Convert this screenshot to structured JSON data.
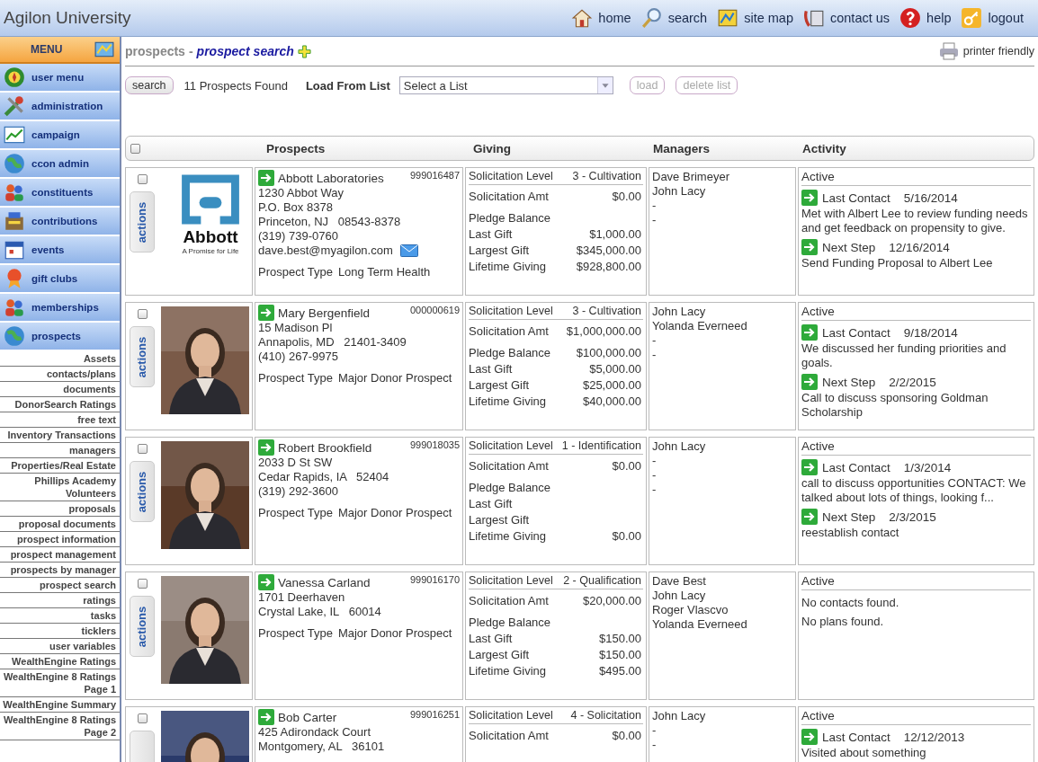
{
  "app_title": "Agilon University",
  "nav": [
    {
      "label": "home"
    },
    {
      "label": "search"
    },
    {
      "label": "site map"
    },
    {
      "label": "contact us"
    },
    {
      "label": "help"
    },
    {
      "label": "logout"
    }
  ],
  "sidebar": {
    "menu_title": "MENU",
    "items": [
      {
        "label": "user menu"
      },
      {
        "label": "administration"
      },
      {
        "label": "campaign"
      },
      {
        "label": "ccon admin"
      },
      {
        "label": "constituents"
      },
      {
        "label": "contributions"
      },
      {
        "label": "events"
      },
      {
        "label": "gift clubs"
      },
      {
        "label": "memberships"
      },
      {
        "label": "prospects"
      }
    ],
    "subitems": [
      "Assets",
      "contacts/plans",
      "documents",
      "DonorSearch Ratings",
      "free text",
      "Inventory Transactions",
      "managers",
      "Properties/Real Estate",
      "Phillips Academy Volunteers",
      "proposals",
      "proposal documents",
      "prospect information",
      "prospect management",
      "prospects by manager",
      "prospect search",
      "ratings",
      "tasks",
      "ticklers",
      "user variables",
      "WealthEngine Ratings",
      "WealthEngine 8 Ratings Page 1",
      "WealthEngine Summary",
      "WealthEngine 8 Ratings Page 2"
    ]
  },
  "breadcrumb": {
    "section": "prospects",
    "separator": "-",
    "page": "prospect search"
  },
  "printer_link": "printer friendly",
  "toolbar": {
    "buttons": [
      {
        "label": "search",
        "disabled": false
      }
    ],
    "found": "11 Prospects Found",
    "list_label": "Load From List",
    "list_select": {
      "value": "Select a List"
    },
    "list_buttons": [
      {
        "label": "load",
        "disabled": true
      },
      {
        "label": "delete list",
        "disabled": true
      }
    ]
  },
  "table": {
    "select_all": {
      "checked": false
    },
    "columns": [
      "Prospects",
      "Giving",
      "Managers",
      "Activity"
    ],
    "rows": [
      {
        "selected": false,
        "action": "actions",
        "image": {
          "kind": "logo",
          "name": "Abbott",
          "tagline": "A Promise for Life"
        },
        "name": "Abbott Laboratories",
        "id": "999016487",
        "address": [
          "1230 Abbot Way",
          "P.O. Box 8378",
          "Princeton, NJ   08543-8378",
          "(319) 739-0760"
        ],
        "email": "dave.best@myagilon.com",
        "type_label": "Prospect Type",
        "type": "Long Term Health",
        "level_label": "Solicitation Level",
        "level": "3 - Cultivation",
        "giving": [
          {
            "label": "Solicitation Amt",
            "value": "$0.00"
          },
          {
            "label": "Pledge Balance"
          },
          {
            "label": "Last Gift",
            "value": "$1,000.00"
          },
          {
            "label": "Largest Gift",
            "value": "$345,000.00"
          },
          {
            "label": "Lifetime Giving",
            "value": "$928,800.00"
          }
        ],
        "managers": [
          "Dave Brimeyer",
          "John Lacy",
          "-",
          "-"
        ],
        "status": "Active",
        "activity": [
          {
            "kind": "event",
            "label": "Last Contact",
            "date": "5/16/2014",
            "text": "Met with Albert Lee to review funding needs and get feedback on propensity to give."
          },
          {
            "kind": "event",
            "label": "Next Step",
            "date": "12/16/2014",
            "text": "Send Funding Proposal to Albert Lee"
          }
        ]
      },
      {
        "selected": false,
        "action": "actions",
        "image": {
          "kind": "picture"
        },
        "name": "Mary Bergenfield",
        "id": "000000619",
        "address": [
          "15 Madison Pl",
          "Annapolis, MD   21401-3409",
          "(410) 267-9975"
        ],
        "type_label": "Prospect Type",
        "type": "Major Donor Prospect",
        "level_label": "Solicitation Level",
        "level": "3 - Cultivation",
        "giving": [
          {
            "label": "Solicitation Amt",
            "value": "$1,000,000.00"
          },
          {
            "label": "Pledge Balance",
            "value": "$100,000.00"
          },
          {
            "label": "Last Gift",
            "value": "$5,000.00"
          },
          {
            "label": "Largest Gift",
            "value": "$25,000.00"
          },
          {
            "label": "Lifetime Giving",
            "value": "$40,000.00"
          }
        ],
        "managers": [
          "John Lacy",
          "Yolanda Everneed",
          "-",
          "-"
        ],
        "status": "Active",
        "activity": [
          {
            "kind": "event",
            "label": "Last Contact",
            "date": "9/18/2014",
            "text": "We discussed her funding priorities and goals."
          },
          {
            "kind": "event",
            "label": "Next Step",
            "date": "2/2/2015",
            "text": "Call to discuss sponsoring Goldman Scholarship"
          }
        ]
      },
      {
        "selected": false,
        "action": "actions",
        "image": {
          "kind": "picture"
        },
        "name": "Robert Brookfield",
        "id": "999018035",
        "address": [
          "2033 D St SW",
          "Cedar Rapids, IA   52404",
          "(319) 292-3600"
        ],
        "type_label": "Prospect Type",
        "type": "Major Donor Prospect",
        "level_label": "Solicitation Level",
        "level": "1 - Identification",
        "giving": [
          {
            "label": "Solicitation Amt",
            "value": "$0.00"
          },
          {
            "label": "Pledge Balance"
          },
          {
            "label": "Last Gift"
          },
          {
            "label": "Largest Gift"
          },
          {
            "label": "Lifetime Giving",
            "value": "$0.00"
          }
        ],
        "managers": [
          "John Lacy",
          "-",
          "-",
          "-"
        ],
        "status": "Active",
        "activity": [
          {
            "kind": "event",
            "label": "Last Contact",
            "date": "1/3/2014",
            "text": "call to discuss opportunities CONTACT: We talked about lots of things, looking f..."
          },
          {
            "kind": "event",
            "label": "Next Step",
            "date": "2/3/2015",
            "text": "reestablish contact"
          }
        ]
      },
      {
        "selected": false,
        "action": "actions",
        "image": {
          "kind": "picture"
        },
        "name": "Vanessa Carland",
        "id": "999016170",
        "address": [
          "1701 Deerhaven",
          "Crystal Lake, IL   60014"
        ],
        "type_label": "Prospect Type",
        "type": "Major Donor Prospect",
        "level_label": "Solicitation Level",
        "level": "2 - Qualification",
        "giving": [
          {
            "label": "Solicitation Amt",
            "value": "$20,000.00"
          },
          {
            "label": "Pledge Balance"
          },
          {
            "label": "Last Gift",
            "value": "$150.00"
          },
          {
            "label": "Largest Gift",
            "value": "$150.00"
          },
          {
            "label": "Lifetime Giving",
            "value": "$495.00"
          }
        ],
        "managers": [
          "Dave Best",
          "John Lacy",
          "Roger Vlascvo",
          "Yolanda Everneed"
        ],
        "status": "Active",
        "activity": [
          {
            "kind": "note",
            "text": "No contacts found."
          },
          {
            "kind": "note",
            "text": "No plans found."
          }
        ]
      },
      {
        "selected": false,
        "image": {
          "kind": "picture"
        },
        "name": "Bob Carter",
        "id": "999016251",
        "address": [
          "425 Adirondack Court",
          "Montgomery, AL   36101"
        ],
        "level_label": "Solicitation Level",
        "level": "4 - Solicitation",
        "giving": [
          {
            "label": "Solicitation Amt",
            "value": "$0.00"
          }
        ],
        "managers": [
          "John Lacy",
          "-",
          "-"
        ],
        "status": "Active",
        "activity": [
          {
            "kind": "event",
            "label": "Last Contact",
            "date": "12/12/2013",
            "text": "Visited about something"
          }
        ]
      }
    ]
  }
}
